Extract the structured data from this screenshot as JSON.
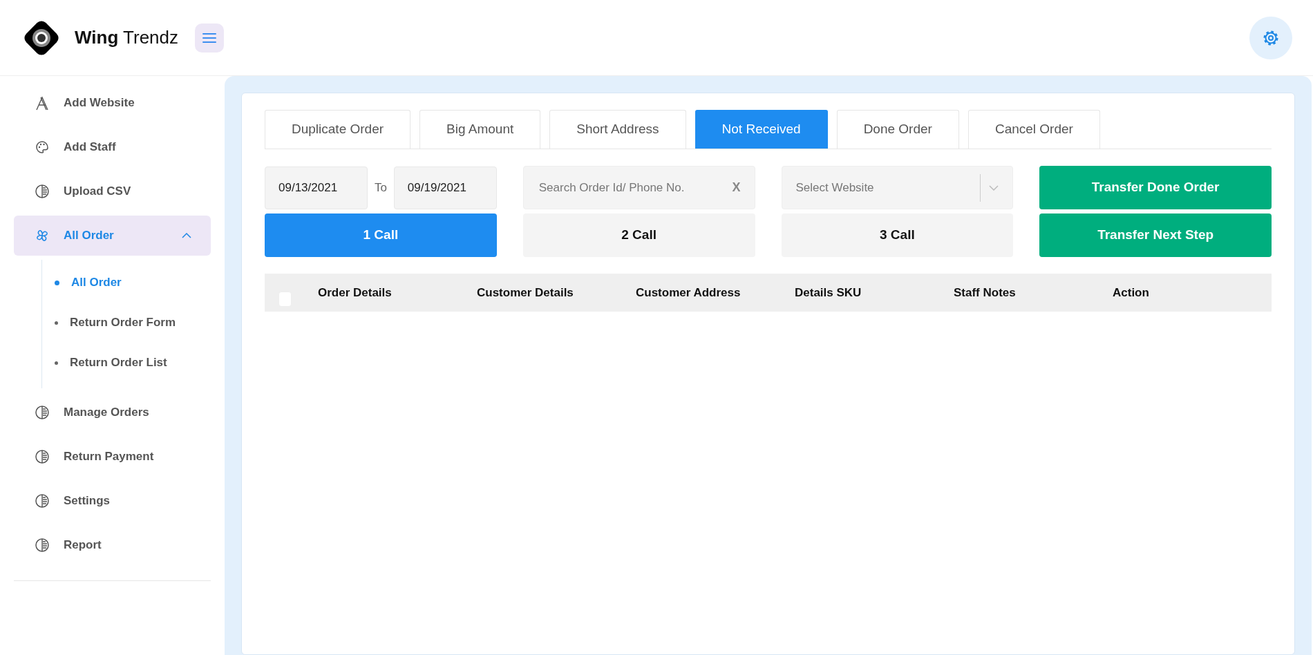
{
  "brand": {
    "name_bold": "Wing",
    "name_rest": "Trendz"
  },
  "sidebar": {
    "items": [
      {
        "label": "Add Website",
        "selected": false
      },
      {
        "label": "Add Staff",
        "selected": false
      },
      {
        "label": "Upload CSV",
        "selected": false
      },
      {
        "label": "All Order",
        "selected": true,
        "expanded": true,
        "children": [
          {
            "label": "All Order",
            "selected": true
          },
          {
            "label": "Return Order Form",
            "selected": false
          },
          {
            "label": "Return Order List",
            "selected": false
          }
        ]
      },
      {
        "label": "Manage Orders",
        "selected": false
      },
      {
        "label": "Return Payment",
        "selected": false
      },
      {
        "label": "Settings",
        "selected": false
      },
      {
        "label": "Report",
        "selected": false
      }
    ]
  },
  "tabs": [
    {
      "label": "Duplicate Order",
      "selected": false
    },
    {
      "label": "Big Amount",
      "selected": false
    },
    {
      "label": "Short Address",
      "selected": false
    },
    {
      "label": "Not Received",
      "selected": true
    },
    {
      "label": "Done Order",
      "selected": false
    },
    {
      "label": "Cancel Order",
      "selected": false
    }
  ],
  "filters": {
    "date_from": "09/13/2021",
    "date_separator": "To",
    "date_to": "09/19/2021",
    "search": {
      "placeholder": "Search Order Id/ Phone No.",
      "clear": "X"
    },
    "website_select": {
      "placeholder": "Select Website"
    }
  },
  "call_buttons": [
    {
      "label": "1 Call",
      "selected": true
    },
    {
      "label": "2 Call",
      "selected": false
    },
    {
      "label": "3 Call",
      "selected": false
    }
  ],
  "transfer_buttons": [
    "Transfer Done Order",
    "Transfer Next Step"
  ],
  "table": {
    "select_all_checked": false,
    "columns": [
      "Order Details",
      "Customer Details",
      "Customer Address",
      "Details SKU",
      "Staff Notes",
      "Action"
    ]
  }
}
